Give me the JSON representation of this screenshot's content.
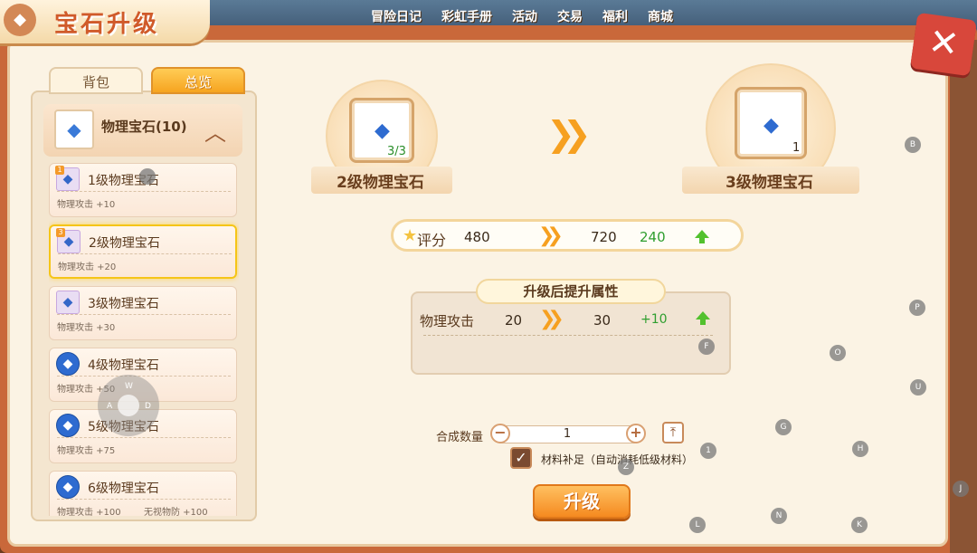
{
  "title": "宝石升级",
  "topnav": [
    "冒险日记",
    "彩虹手册",
    "活动",
    "交易",
    "福利",
    "商城"
  ],
  "tabs": [
    {
      "label": "背包",
      "active": false
    },
    {
      "label": "总览",
      "active": true
    }
  ],
  "category": {
    "label": "物理宝石(10)",
    "expanded": true
  },
  "gem_list": [
    {
      "badge": "1",
      "name": "1级物理宝石",
      "stat": "物理攻击 +10",
      "stat2": "",
      "selected": false,
      "icon": "gem-small-icon"
    },
    {
      "badge": "3",
      "name": "2级物理宝石",
      "stat": "物理攻击 +20",
      "stat2": "",
      "selected": true,
      "icon": "gem-small-icon"
    },
    {
      "badge": "",
      "name": "3级物理宝石",
      "stat": "物理攻击 +30",
      "stat2": "",
      "selected": false,
      "icon": "gem-small-icon"
    },
    {
      "badge": "",
      "name": "4级物理宝石",
      "stat": "物理攻击 +50",
      "stat2": "",
      "selected": false,
      "icon": "gem-blue-icon"
    },
    {
      "badge": "",
      "name": "5级物理宝石",
      "stat": "物理攻击 +75",
      "stat2": "",
      "selected": false,
      "icon": "gem-blue-icon"
    },
    {
      "badge": "",
      "name": "6级物理宝石",
      "stat": "物理攻击 +100",
      "stat2": "无视物防 +100",
      "selected": false,
      "icon": "gem-blue-icon"
    }
  ],
  "source_slot": {
    "count": "3/3",
    "name": "2级物理宝石"
  },
  "target_slot": {
    "count": "1",
    "name": "3级物理宝石"
  },
  "score": {
    "label": "评分",
    "from": "480",
    "to": "720",
    "diff": "240"
  },
  "attributes": {
    "title": "升级后提升属性",
    "rows": [
      {
        "label": "物理攻击",
        "from": "20",
        "to": "30",
        "diff": "+10"
      }
    ]
  },
  "quantity": {
    "label": "合成数量",
    "value": "1"
  },
  "auto_material": {
    "label": "材料补足（自动消耗低级材料）",
    "checked": true
  },
  "upgrade_button": "升级",
  "key_hints": [
    "B",
    "F",
    "P",
    "O",
    "U",
    "G",
    "H",
    "1",
    "Z",
    "J",
    "L",
    "N",
    "K"
  ],
  "joystick_keys": [
    "W",
    "A",
    "D"
  ],
  "colors": {
    "accent": "#f6a020",
    "positive": "#2f9e2f",
    "frame": "#c9683a",
    "close": "#d8473b"
  }
}
